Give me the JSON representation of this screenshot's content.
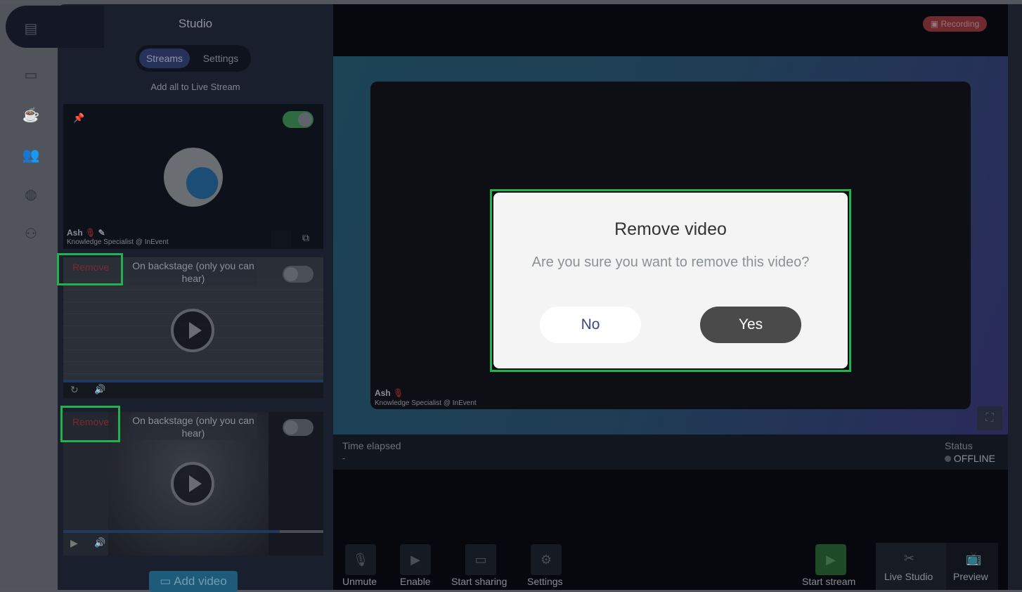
{
  "sidebar": {
    "title": "Studio",
    "tabs": [
      {
        "label": "Streams",
        "active": true
      },
      {
        "label": "Settings",
        "active": false
      }
    ],
    "add_all": "Add all to Live Stream",
    "rail_icons": [
      "film-icon",
      "laptop-icon",
      "coffee-icon",
      "users-icon",
      "globe-icon",
      "group-icon"
    ],
    "cards": [
      {
        "name": "Ash",
        "subtitle": "Knowledge Specialist @ InEvent",
        "toggle_on": true
      },
      {
        "remove": "Remove",
        "status": "On backstage (only you can hear)",
        "toggle_on": false,
        "progress": 100
      },
      {
        "remove": "Remove",
        "status": "On backstage (only you can hear)",
        "toggle_on": false,
        "progress": 83
      }
    ],
    "add_video": "Add video"
  },
  "main": {
    "recording": "Recording",
    "speaker": {
      "name": "Ash",
      "subtitle": "Knowledge Specialist @ InEvent"
    },
    "time_elapsed_label": "Time elapsed",
    "time_elapsed": "-",
    "status_label": "Status",
    "status": "OFFLINE"
  },
  "modal": {
    "title": "Remove video",
    "message": "Are you sure you want to remove this video?",
    "no": "No",
    "yes": "Yes"
  },
  "toolbar": {
    "unmute": "Unmute",
    "enable": "Enable",
    "start_sharing": "Start sharing",
    "settings": "Settings",
    "start_stream": "Start stream",
    "live_studio": "Live Studio",
    "preview": "Preview"
  },
  "colors": {
    "highlight": "#22b14c",
    "recording": "#7a2a30",
    "toggle_on": "#2e7d45"
  }
}
